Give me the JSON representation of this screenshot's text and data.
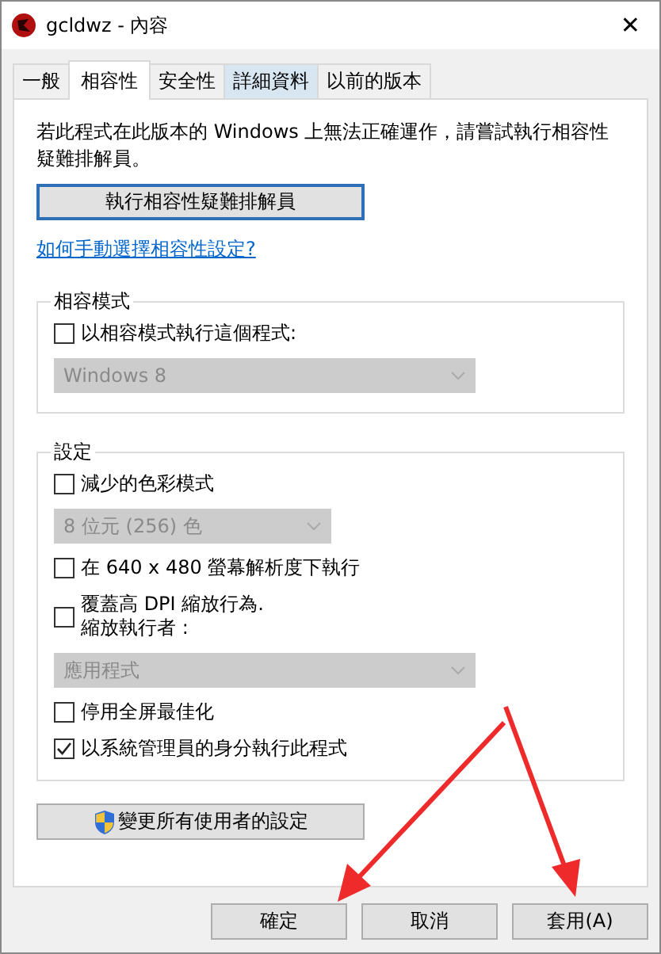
{
  "window": {
    "title": "gcldwz - 內容",
    "close": "✕"
  },
  "tabs": [
    {
      "label": "一般",
      "selected": false
    },
    {
      "label": "相容性",
      "selected": true
    },
    {
      "label": "安全性",
      "selected": false
    },
    {
      "label": "詳細資料",
      "selected": false
    },
    {
      "label": "以前的版本",
      "selected": false
    }
  ],
  "intro": "若此程式在此版本的 Windows 上無法正確運作，請嘗試執行相容性疑難排解員。",
  "troubleshoot_button": "執行相容性疑難排解員",
  "help_link": "如何手動選擇相容性設定?",
  "compat_mode": {
    "legend": "相容模式",
    "items": [
      {
        "kind": "checkbox",
        "label": "以相容模式執行這個程式:",
        "checked": false
      },
      {
        "kind": "dropdown",
        "value": "Windows 8",
        "disabled": true,
        "wide": true
      }
    ]
  },
  "settings": {
    "legend": "設定",
    "items": [
      {
        "kind": "checkbox",
        "label": "減少的色彩模式",
        "checked": false
      },
      {
        "kind": "dropdown",
        "value": "8 位元 (256) 色",
        "disabled": true,
        "wide": false
      },
      {
        "kind": "checkbox",
        "label": "在 640 x 480 螢幕解析度下執行",
        "checked": false
      },
      {
        "kind": "checkbox",
        "label": "覆蓋高 DPI 縮放行為.\n縮放執行者 :",
        "checked": false
      },
      {
        "kind": "dropdown",
        "value": "應用程式",
        "disabled": true,
        "wide": true
      },
      {
        "kind": "checkbox",
        "label": "停用全屏最佳化",
        "checked": false
      },
      {
        "kind": "checkbox",
        "label": "以系統管理員的身分執行此程式",
        "checked": true
      }
    ]
  },
  "all_users_button": "變更所有使用者的設定",
  "buttons": [
    "確定",
    "取消",
    "套用(A)"
  ]
}
